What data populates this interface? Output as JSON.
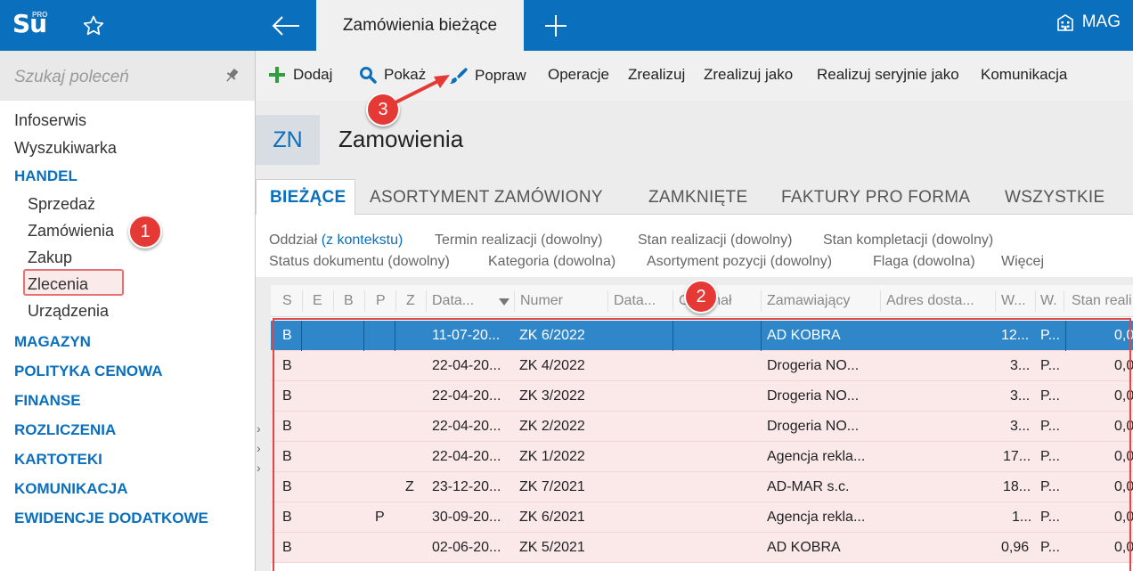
{
  "app": {
    "logo_text": "Su",
    "logo_sup": "PRO",
    "active_tab": "Zamówienia bieżące",
    "company": "MAG"
  },
  "sidebar": {
    "search_placeholder": "Szukaj poleceń",
    "items": [
      {
        "label": "Infoserwis",
        "type": "item"
      },
      {
        "label": "Wyszukiwarka",
        "type": "item"
      },
      {
        "label": "HANDEL",
        "type": "section"
      },
      {
        "label": "Sprzedaż",
        "type": "sub"
      },
      {
        "label": "Zamówienia",
        "type": "sub"
      },
      {
        "label": "Zakup",
        "type": "sub"
      },
      {
        "label": "Zlecenia",
        "type": "sub"
      },
      {
        "label": "Urządzenia",
        "type": "sub"
      },
      {
        "label": "MAGAZYN",
        "type": "section"
      },
      {
        "label": "POLITYKA CENOWA",
        "type": "section"
      },
      {
        "label": "FINANSE",
        "type": "section"
      },
      {
        "label": "ROZLICZENIA",
        "type": "section"
      },
      {
        "label": "KARTOTEKI",
        "type": "section"
      },
      {
        "label": "KOMUNIKACJA",
        "type": "section"
      },
      {
        "label": "EWIDENCJE DODATKOWE",
        "type": "section"
      }
    ]
  },
  "toolbar": {
    "add": "Dodaj",
    "show": "Pokaż",
    "edit": "Popraw",
    "operations": "Operacje",
    "realize": "Zrealizuj",
    "realize_as": "Zrealizuj jako",
    "realize_serial": "Realizuj seryjnie jako",
    "communication": "Komunikacja"
  },
  "header": {
    "code": "ZN",
    "title": "Zamowienia"
  },
  "tabs": [
    "BIEŻĄCE",
    "ASORTYMENT ZAMÓWIONY",
    "ZAMKNIĘTE",
    "FAKTURY PRO FORMA",
    "WSZYSTKIE"
  ],
  "filters": {
    "branch_label": "Oddział",
    "branch_value": "(z kontekstu)",
    "realization_term": "Termin realizacji (dowolny)",
    "realization_state": "Stan realizacji (dowolny)",
    "completion_state": "Stan kompletacji (dowolny)",
    "doc_status": "Status dokumentu (dowolny)",
    "category": "Kategoria (dowolna)",
    "item_assortment": "Asortyment pozycji (dowolny)",
    "flag": "Flaga (dowolna)",
    "more": "Więcej"
  },
  "grid": {
    "columns": [
      "S",
      "E",
      "B",
      "P",
      "Z",
      "Data...",
      "Numer",
      "Data...",
      "Oryginał",
      "Zamawiający",
      "Adres dosta...",
      "W...",
      "W.",
      "Stan reali"
    ],
    "rows": [
      {
        "s": "B",
        "p": "",
        "z": "",
        "date": "11-07-20...",
        "number": "ZK 6/2022",
        "customer": "AD KOBRA",
        "w1": "12...",
        "w2": "P...",
        "stan": "0,0"
      },
      {
        "s": "B",
        "p": "",
        "z": "",
        "date": "22-04-20...",
        "number": "ZK 4/2022",
        "customer": "Drogeria NO...",
        "w1": "3...",
        "w2": "P...",
        "stan": "0,0"
      },
      {
        "s": "B",
        "p": "",
        "z": "",
        "date": "22-04-20...",
        "number": "ZK 3/2022",
        "customer": "Drogeria NO...",
        "w1": "3...",
        "w2": "P...",
        "stan": "0,0"
      },
      {
        "s": "B",
        "p": "",
        "z": "",
        "date": "22-04-20...",
        "number": "ZK 2/2022",
        "customer": "Drogeria NO...",
        "w1": "3...",
        "w2": "P...",
        "stan": "0,0"
      },
      {
        "s": "B",
        "p": "",
        "z": "",
        "date": "22-04-20...",
        "number": "ZK 1/2022",
        "customer": "Agencja rekla...",
        "w1": "17...",
        "w2": "P...",
        "stan": "0,0"
      },
      {
        "s": "B",
        "p": "",
        "z": "Z",
        "date": "23-12-20...",
        "number": "ZK 7/2021",
        "customer": "AD-MAR s.c.",
        "w1": "18...",
        "w2": "P...",
        "stan": "0,0"
      },
      {
        "s": "B",
        "p": "P",
        "z": "",
        "date": "30-09-20...",
        "number": "ZK 6/2021",
        "customer": "Agencja rekla...",
        "w1": "1...",
        "w2": "P...",
        "stan": "0,0"
      },
      {
        "s": "B",
        "p": "",
        "z": "",
        "date": "02-06-20...",
        "number": "ZK 5/2021",
        "customer": "AD KOBRA",
        "w1": "0,96",
        "w2": "P...",
        "stan": "0,0"
      }
    ]
  },
  "annotations": {
    "badge1": "1",
    "badge2": "2",
    "badge3": "3"
  },
  "colors": {
    "brand": "#0a6fbc",
    "annotation": "#e53935",
    "selected_row": "#2f86c9",
    "highlight_rows": "#fbe9ea"
  }
}
